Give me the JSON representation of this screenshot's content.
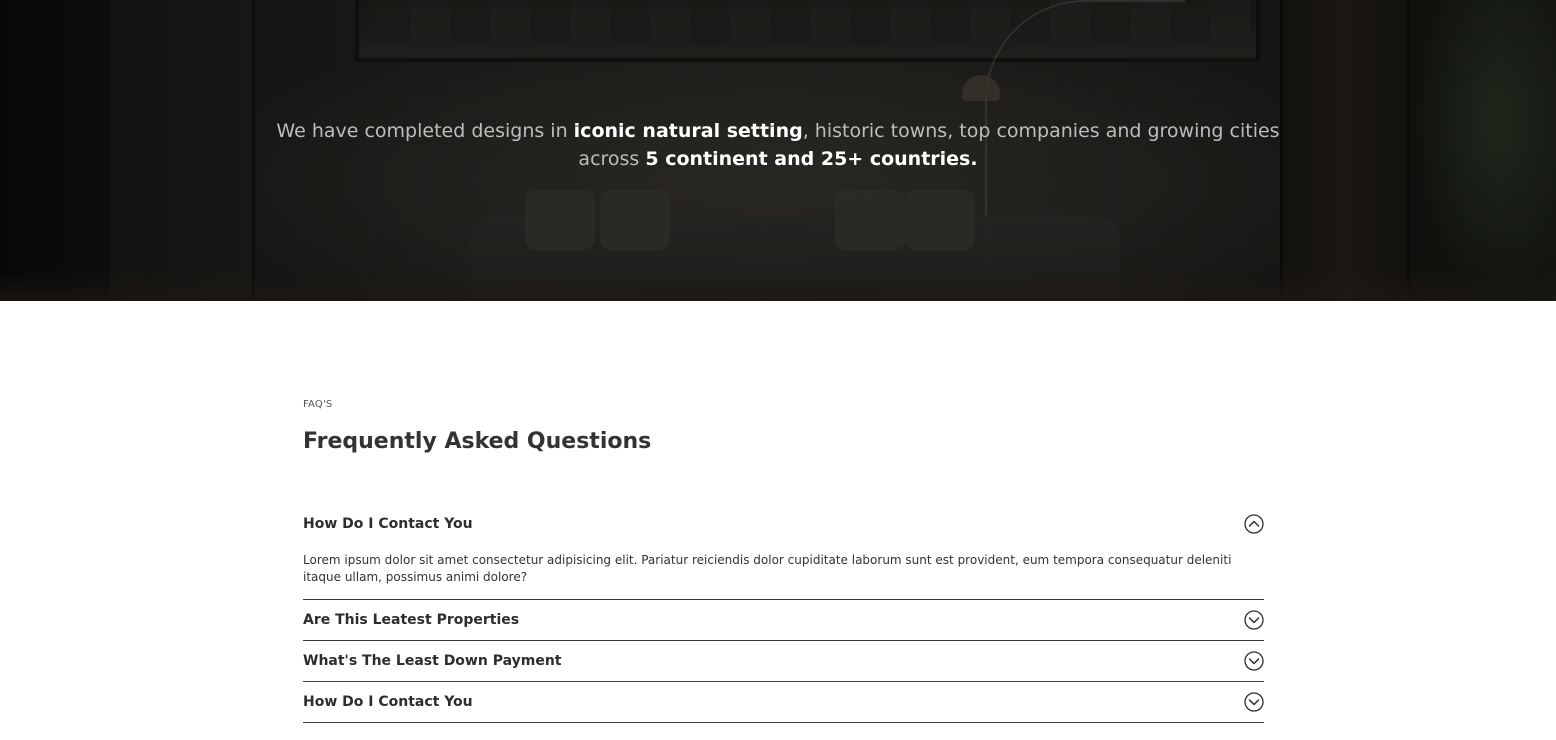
{
  "hero": {
    "line1_a": "We have completed designs in ",
    "line1_b": "iconic natural setting",
    "line1_c": ", historic towns, top companies and growing cities",
    "line2_a": "across ",
    "line2_b": "5 continent and 25+ countries."
  },
  "faq": {
    "eyebrow": "FAQ'S",
    "title": "Frequently Asked Questions",
    "items": [
      {
        "question": "How Do I Contact You",
        "answer": "Lorem ipsum dolor sit amet consectetur adipisicing elit. Pariatur reiciendis dolor cupiditate laborum sunt est provident, eum tempora consequatur deleniti itaque ullam, possimus animi dolore?",
        "expanded": true,
        "icon": "chevron-up-circle-icon"
      },
      {
        "question": "Are This Leatest Properties",
        "expanded": false,
        "icon": "chevron-down-circle-icon"
      },
      {
        "question": "What's The Least Down Payment",
        "expanded": false,
        "icon": "chevron-down-circle-icon"
      },
      {
        "question": "How Do I Contact You",
        "expanded": false,
        "icon": "chevron-down-circle-icon"
      }
    ]
  },
  "colors": {
    "hero_text": "#bdbdbd",
    "hero_highlight": "#ffffff",
    "divider": "#3a3a3a",
    "heading": "#333333"
  }
}
